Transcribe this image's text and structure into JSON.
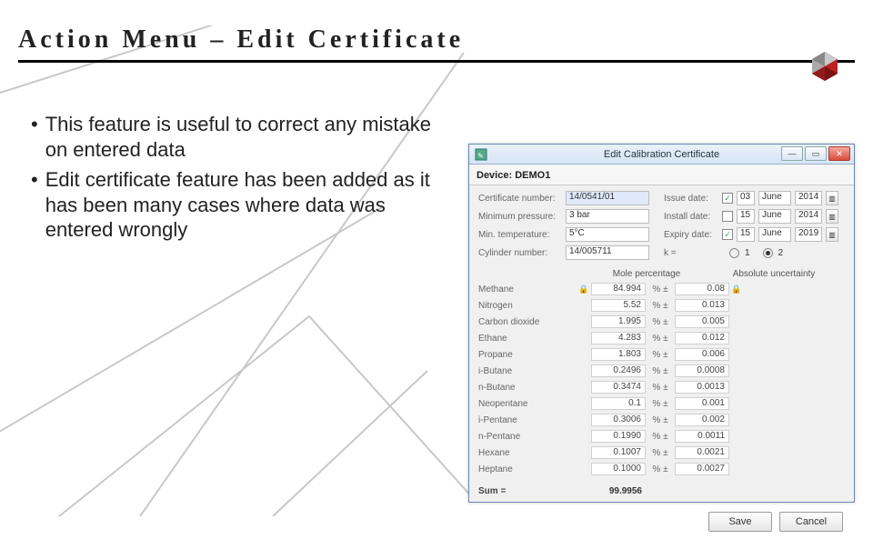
{
  "title": "Action Menu – Edit Certificate",
  "bullets": [
    "This feature is useful to correct any mistake on entered data",
    "Edit certificate feature has been added as it has been many cases where data was entered wrongly"
  ],
  "window": {
    "title": "Edit Calibration Certificate",
    "device_label": "Device:",
    "device_value": "DEMO1",
    "fields": {
      "cert_label": "Certificate number:",
      "cert_value": "14/0541/01",
      "issue_label": "Issue date:",
      "issue_check": "✓",
      "issue_day": "03",
      "issue_month": "June",
      "issue_year": "2014",
      "minp_label": "Minimum pressure:",
      "minp_value": "3 bar",
      "install_label": "Install date:",
      "install_day": "15",
      "install_month": "June",
      "install_year": "2014",
      "mint_label": "Min. temperature:",
      "mint_value": "5°C",
      "expiry_label": "Expiry date:",
      "expiry_check": "✓",
      "expiry_day": "15",
      "expiry_month": "June",
      "expiry_year": "2019",
      "cyl_label": "Cylinder number:",
      "cyl_value": "14/005711",
      "k_label": "k =",
      "k1": "1",
      "k2": "2"
    },
    "headers": {
      "mole": "Mole percentage",
      "unc": "Absolute uncertainty"
    },
    "rows": [
      {
        "name": "Methane",
        "lock": "🔒",
        "mole": "84.994",
        "unc": "0.08",
        "lock2": "🔒"
      },
      {
        "name": "Nitrogen",
        "lock": "",
        "mole": "5.52",
        "unc": "0.013",
        "lock2": ""
      },
      {
        "name": "Carbon dioxide",
        "lock": "",
        "mole": "1.995",
        "unc": "0.005",
        "lock2": ""
      },
      {
        "name": "Ethane",
        "lock": "",
        "mole": "4.283",
        "unc": "0.012",
        "lock2": ""
      },
      {
        "name": "Propane",
        "lock": "",
        "mole": "1.803",
        "unc": "0.006",
        "lock2": ""
      },
      {
        "name": "i-Butane",
        "lock": "",
        "mole": "0.2496",
        "unc": "0.0008",
        "lock2": ""
      },
      {
        "name": "n-Butane",
        "lock": "",
        "mole": "0.3474",
        "unc": "0.0013",
        "lock2": ""
      },
      {
        "name": "Neopentane",
        "lock": "",
        "mole": "0.1",
        "unc": "0.001",
        "lock2": ""
      },
      {
        "name": "i-Pentane",
        "lock": "",
        "mole": "0.3006",
        "unc": "0.002",
        "lock2": ""
      },
      {
        "name": "n-Pentane",
        "lock": "",
        "mole": "0.1990",
        "unc": "0.0011",
        "lock2": ""
      },
      {
        "name": "Hexane",
        "lock": "",
        "mole": "0.1007",
        "unc": "0.0021",
        "lock2": ""
      },
      {
        "name": "Heptane",
        "lock": "",
        "mole": "0.1000",
        "unc": "0.0027",
        "lock2": ""
      }
    ],
    "sum_label": "Sum =",
    "sum_value": "99.9956",
    "pct_unit": "%  ±",
    "save": "Save",
    "cancel": "Cancel"
  }
}
